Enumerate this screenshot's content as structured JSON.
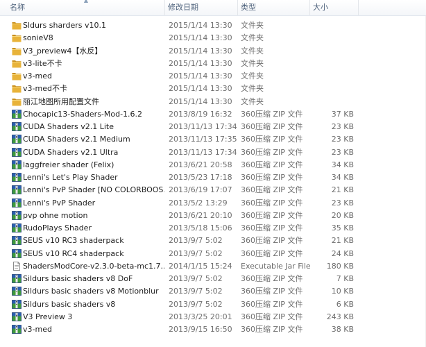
{
  "columns": {
    "name": "名称",
    "date": "修改日期",
    "type": "类型",
    "size": "大小"
  },
  "colors": {
    "folder": "#e8b33a",
    "folder_dark": "#c98f1d",
    "archive_blue": "#2a5fb0",
    "archive_green": "#3f9a3c",
    "header_text": "#4c607a"
  },
  "files": [
    {
      "name": "Sldurs sharders v10.1",
      "date": "2015/1/14 13:30",
      "type": "文件夹",
      "size": "",
      "icon": "folder-icon"
    },
    {
      "name": "sonieV8",
      "date": "2015/1/14 13:30",
      "type": "文件夹",
      "size": "",
      "icon": "folder-icon"
    },
    {
      "name": "V3_preview4【水反】",
      "date": "2015/1/14 13:30",
      "type": "文件夹",
      "size": "",
      "icon": "folder-icon"
    },
    {
      "name": "v3-lite不卡",
      "date": "2015/1/14 13:30",
      "type": "文件夹",
      "size": "",
      "icon": "folder-icon"
    },
    {
      "name": "v3-med",
      "date": "2015/1/14 13:30",
      "type": "文件夹",
      "size": "",
      "icon": "folder-icon"
    },
    {
      "name": "v3-med不卡",
      "date": "2015/1/14 13:30",
      "type": "文件夹",
      "size": "",
      "icon": "folder-icon"
    },
    {
      "name": "丽江地图所用配置文件",
      "date": "2015/1/14 13:30",
      "type": "文件夹",
      "size": "",
      "icon": "folder-icon"
    },
    {
      "name": "Chocapic13-Shaders-Mod-1.6.2",
      "date": "2013/8/19 16:32",
      "type": "360压缩 ZIP 文件",
      "size": "37 KB",
      "icon": "zip-archive-icon"
    },
    {
      "name": "CUDA Shaders v2.1 Lite",
      "date": "2013/11/13 17:34",
      "type": "360压缩 ZIP 文件",
      "size": "23 KB",
      "icon": "zip-archive-icon"
    },
    {
      "name": "CUDA Shaders v2.1 Medium",
      "date": "2013/11/13 17:35",
      "type": "360压缩 ZIP 文件",
      "size": "23 KB",
      "icon": "zip-archive-icon"
    },
    {
      "name": "CUDA Shaders v2.1 Ultra",
      "date": "2013/11/13 17:34",
      "type": "360压缩 ZIP 文件",
      "size": "23 KB",
      "icon": "zip-archive-icon"
    },
    {
      "name": "laggfreier shader (Felix)",
      "date": "2013/6/21 20:58",
      "type": "360压缩 ZIP 文件",
      "size": "34 KB",
      "icon": "zip-archive-icon"
    },
    {
      "name": "Lenni's Let's Play Shader",
      "date": "2013/5/23 17:18",
      "type": "360压缩 ZIP 文件",
      "size": "34 KB",
      "icon": "zip-archive-icon"
    },
    {
      "name": "Lenni's PvP Shader [NO COLORBOOS...",
      "date": "2013/6/19 17:07",
      "type": "360压缩 ZIP 文件",
      "size": "21 KB",
      "icon": "zip-archive-icon"
    },
    {
      "name": "Lenni's PvP Shader",
      "date": "2013/5/2 13:29",
      "type": "360压缩 ZIP 文件",
      "size": "23 KB",
      "icon": "zip-archive-icon"
    },
    {
      "name": "pvp ohne motion",
      "date": "2013/6/21 20:10",
      "type": "360压缩 ZIP 文件",
      "size": "20 KB",
      "icon": "zip-archive-icon"
    },
    {
      "name": "RudoPlays Shader",
      "date": "2013/5/18 15:06",
      "type": "360压缩 ZIP 文件",
      "size": "35 KB",
      "icon": "zip-archive-icon"
    },
    {
      "name": "SEUS v10 RC3 shaderpack",
      "date": "2013/9/7 5:02",
      "type": "360压缩 ZIP 文件",
      "size": "21 KB",
      "icon": "zip-archive-icon"
    },
    {
      "name": "SEUS v10 RC4 shaderpack",
      "date": "2013/9/7 5:02",
      "type": "360压缩 ZIP 文件",
      "size": "24 KB",
      "icon": "zip-archive-icon"
    },
    {
      "name": "ShadersModCore-v2.3.0-beta-mc1.7....",
      "date": "2014/1/15 15:24",
      "type": "Executable Jar File",
      "size": "180 KB",
      "icon": "jar-file-icon"
    },
    {
      "name": "Sildurs basic shaders v8 DoF",
      "date": "2013/9/7 5:02",
      "type": "360压缩 ZIP 文件",
      "size": "7 KB",
      "icon": "zip-archive-icon"
    },
    {
      "name": "Sildurs basic shaders v8 Motionblur",
      "date": "2013/9/7 5:02",
      "type": "360压缩 ZIP 文件",
      "size": "10 KB",
      "icon": "zip-archive-icon"
    },
    {
      "name": "Sildurs basic shaders v8",
      "date": "2013/9/7 5:02",
      "type": "360压缩 ZIP 文件",
      "size": "6 KB",
      "icon": "zip-archive-icon"
    },
    {
      "name": "V3 Preview 3",
      "date": "2013/3/25 20:01",
      "type": "360压缩 ZIP 文件",
      "size": "243 KB",
      "icon": "zip-archive-icon"
    },
    {
      "name": "v3-med",
      "date": "2013/9/15 16:50",
      "type": "360压缩 ZIP 文件",
      "size": "38 KB",
      "icon": "zip-archive-icon"
    }
  ]
}
